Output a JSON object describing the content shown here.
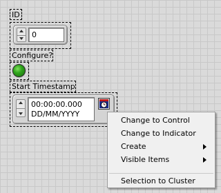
{
  "controls": {
    "id": {
      "label": "ID",
      "value": "0"
    },
    "configure": {
      "label": "Configure?",
      "led_color": "#1f8c10"
    },
    "timestamp": {
      "label": "Start Timestamp",
      "time": "00:00:00.000",
      "date": "DD/MM/YYYY"
    }
  },
  "context_menu": {
    "items": [
      {
        "label": "Change to Control",
        "submenu": false
      },
      {
        "label": "Change to Indicator",
        "submenu": false
      },
      {
        "label": "Create",
        "submenu": true
      },
      {
        "label": "Visible Items",
        "submenu": true
      },
      {
        "label": "Selection to Cluster",
        "submenu": false
      }
    ]
  },
  "icons": {
    "calendar_browse": "calendar-clock-icon",
    "submenu_arrow": "chevron-right-icon"
  }
}
